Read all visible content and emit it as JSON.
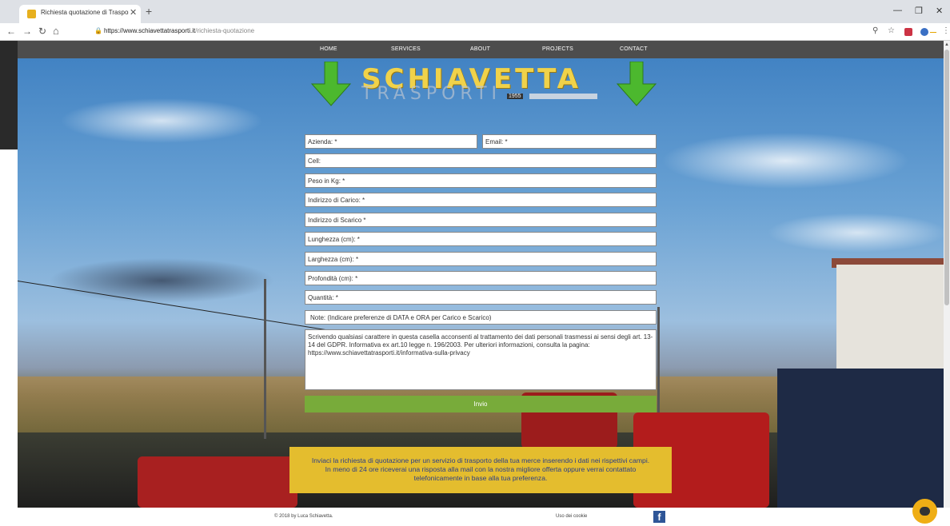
{
  "browser": {
    "tab_title": "Richiesta quotazione di Trasport",
    "url_domain": "https://www.schiavettatrasporti.it",
    "url_path": "/richiesta-quotazione"
  },
  "nav": {
    "items": [
      "HOME",
      "SERVICES",
      "ABOUT",
      "PROJECTS",
      "CONTACT"
    ]
  },
  "logo": {
    "title": "SCHIAVETTA",
    "subtitle": "TRASPORTI",
    "year": "1955"
  },
  "form": {
    "azienda": "Azienda: *",
    "email": "Email: *",
    "cell": "Cell:",
    "peso": "Peso in Kg: *",
    "carico": "Indirizzo di Carico: *",
    "scarico": "Indirizzo di Scarico *",
    "lunghezza": "Lunghezza (cm): *",
    "larghezza": "Larghezza (cm): *",
    "profondita": "Profondità (cm): *",
    "quantita": "Quantità: *",
    "note": "Note: (Indicare preferenze di DATA e ORA per Carico e Scarico)",
    "privacy_text": "Scrivendo qualsiasi carattere in questa casella acconsenti al trattamento dei dati personali trasmessi ai sensi degli art. 13-14 del GDPR. Informativa ex art.10 legge n. 196/2003. Per ulteriori informazioni, consulta la pagina: https://www.schiavettatrasporti.it/informativa-sulla-privacy",
    "submit_label": "Invio"
  },
  "info_box": {
    "line1": "Inviaci la richiesta di quotazione per un servizio di trasporto della tua merce inserendo i dati nei rispettivi campi.",
    "line2": "In meno di 24 ore riceverai una risposta alla mail con la nostra migliore offerta oppure verrai contattato",
    "line3": "telefonicamente in base alla tua preferenza."
  },
  "footer": {
    "copyright": "© 2018 by Luca Schiavetta.",
    "cookie": "Uso dei cookie",
    "facebook_icon": "f"
  },
  "colors": {
    "nav_bg": "#4d4d4d",
    "submit_green": "#78ab3a",
    "info_yellow": "#e4bd2e",
    "info_text": "#2b3e88",
    "logo_gold": "#f0d24a",
    "arrow_green": "#4cb82e"
  }
}
